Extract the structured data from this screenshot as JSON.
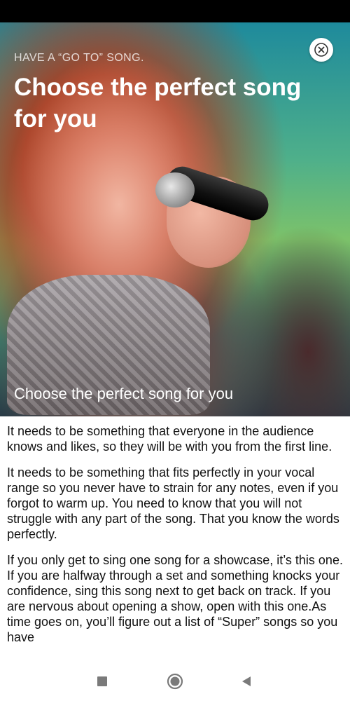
{
  "hero": {
    "eyebrow": "HAVE A “GO TO” SONG.",
    "title": "Choose the perfect song for you",
    "caption": "Choose the perfect song for you"
  },
  "article": {
    "paragraphs": [
      "It needs to be something that everyone in the audience knows and likes, so they will be with you from the first line.",
      "It needs to be something that fits perfectly in your vocal range so you never have to strain for any notes, even if you forgot to warm up. You need to know that you will not struggle with any part of the song. That you know the words perfectly.",
      "If you only get to sing one song for a showcase, it’s this one. If you are halfway through a set and something knocks your confidence, sing this song next to get back on track. If you are nervous about opening a show, open with this one.As time goes on, you’ll figure out a list of “Super” songs so you have"
    ]
  },
  "icons": {
    "close": "close-icon",
    "recents": "recents-square-icon",
    "home": "home-circle-icon",
    "back": "back-triangle-icon"
  },
  "colors": {
    "status_bar": "#000000",
    "text": "#111111",
    "nav_icon": "#7a7a7a"
  }
}
